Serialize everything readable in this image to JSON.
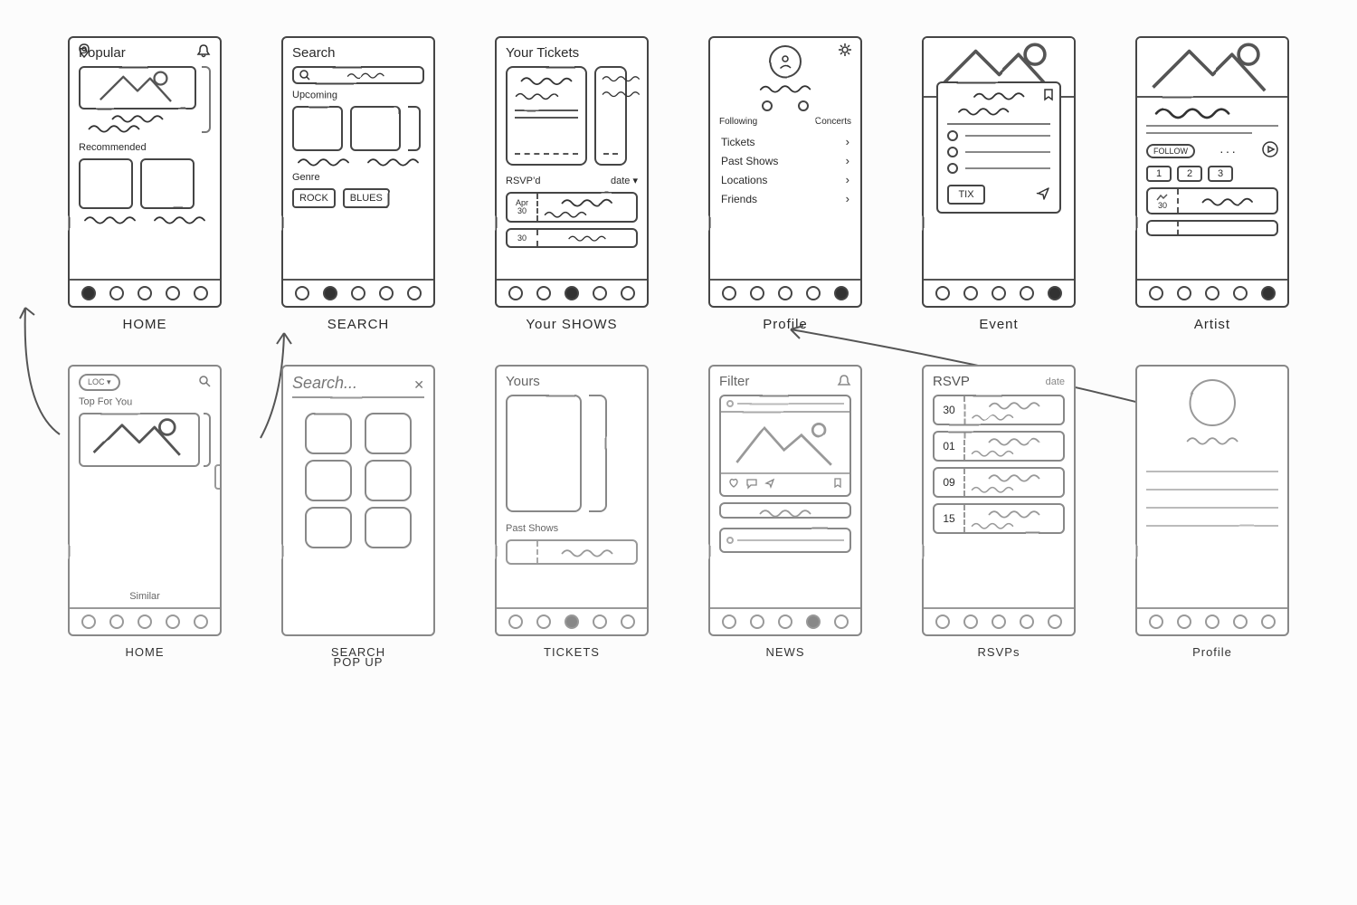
{
  "screens": {
    "home": {
      "caption": "HOME",
      "section_popular": "Popular",
      "section_recommended": "Recommended",
      "active_tab": 0
    },
    "search": {
      "caption": "SEARCH",
      "title": "Search",
      "placeholder": "",
      "section_upcoming": "Upcoming",
      "section_genre": "Genre",
      "genre_1": "ROCK",
      "genre_2": "BLUES",
      "active_tab": 1
    },
    "your_shows": {
      "caption": "Your SHOWS",
      "title": "Your Tickets",
      "section_rsvp": "RSVP’d",
      "date_label": "date ▾",
      "row_month": "Apr",
      "row_day1": "30",
      "row_day2": "30",
      "active_tab": 2
    },
    "profile": {
      "caption": "Profile",
      "tab_following": "Following",
      "tab_concerts": "Concerts",
      "items": [
        "Tickets",
        "Past Shows",
        "Locations",
        "Friends"
      ],
      "active_tab": 4
    },
    "event": {
      "caption": "Event",
      "button_tix": "TIX",
      "active_tab": 4
    },
    "artist": {
      "caption": "Artist",
      "follow": "FOLLOW",
      "pills": [
        "1",
        "2",
        "3"
      ],
      "date1": "30",
      "active_tab": 4
    },
    "home2": {
      "caption": "HOME",
      "chip": "LOC ▾",
      "section_top": "Top For You",
      "section_similar": "Similar",
      "active_tab": 0
    },
    "search_popup": {
      "caption": "SEARCH",
      "caption2": "POP UP",
      "title": "Search...",
      "close": "✕"
    },
    "tickets": {
      "caption": "TICKETS",
      "section_yours": "Yours",
      "section_past": "Past Shows",
      "active_tab": 2
    },
    "news": {
      "caption": "NEWS",
      "title": "Filter",
      "active_tab": 3
    },
    "rsvps": {
      "caption": "RSVPs",
      "title": "RSVP",
      "date_label": "date",
      "days": [
        "30",
        "01",
        "09",
        "15"
      ],
      "active_tab": -1
    },
    "profile2": {
      "caption": "Profile",
      "active_tab": -1
    }
  },
  "nav_count": 5
}
